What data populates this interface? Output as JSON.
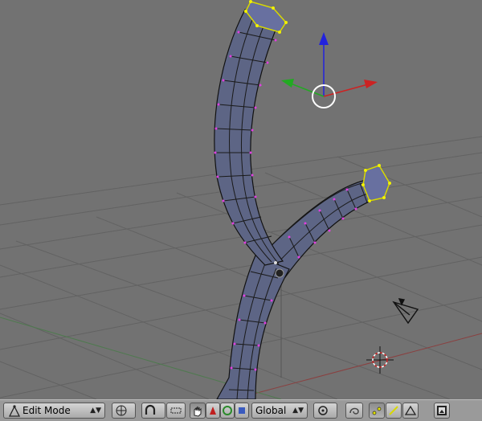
{
  "viewport": {
    "name": "3d-viewport",
    "colors": {
      "background": "#727272",
      "grid": "#5e5e5e",
      "mesh_fill": "#5d6585",
      "mesh_edge": "#111111",
      "vertex": "#e040e0",
      "selected_vertex": "#f2f200",
      "x_axis": "#cc2222",
      "y_axis": "#22aa22",
      "z_axis": "#2222dd"
    }
  },
  "header": {
    "mode": {
      "label": "Edit Mode",
      "icon": "edit-mesh-icon"
    },
    "orientation": {
      "label": "Global"
    },
    "icons": [
      "viewport-shading-icon",
      "snap-magnet-icon",
      "proportional-icon",
      "hand-grab-icon",
      "translate-icon",
      "rotate-icon",
      "scale-icon",
      "pivot-icon",
      "vertex-select-icon",
      "edge-select-icon",
      "face-select-icon",
      "render-icon"
    ]
  }
}
